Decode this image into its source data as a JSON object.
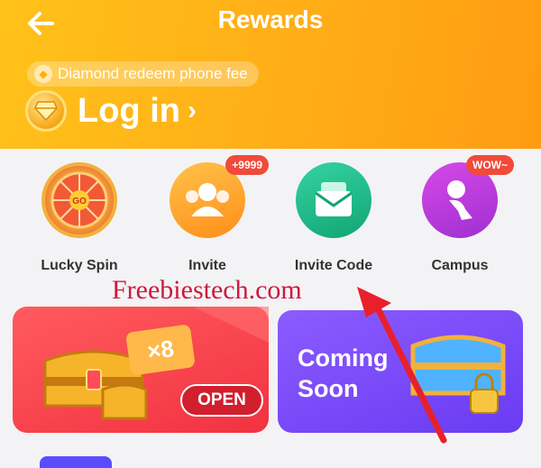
{
  "header": {
    "title": "Rewards",
    "promo_pill": "Diamond redeem phone fee",
    "login_label": "Log in",
    "login_chevron": "›"
  },
  "features": [
    {
      "label": "Lucky Spin",
      "icon": "lucky-spin-wheel-icon",
      "badge": ""
    },
    {
      "label": "Invite",
      "icon": "people-icon",
      "badge": "+9999"
    },
    {
      "label": "Invite Code",
      "icon": "envelope-icon",
      "badge": ""
    },
    {
      "label": "Campus",
      "icon": "person-pin-icon",
      "badge": "WOW~"
    }
  ],
  "cards": {
    "left": {
      "multiplier": "×8",
      "button_label": "OPEN"
    },
    "right": {
      "line1": "Coming",
      "line2": "Soon"
    }
  },
  "watermark": "Freebiestech.com",
  "spin_label": "GO",
  "colors": {
    "header": "#ffb117",
    "card_left": "#f23241",
    "card_right": "#7549f5",
    "badge": "#f14a3a",
    "watermark": "#cc1a3b"
  }
}
